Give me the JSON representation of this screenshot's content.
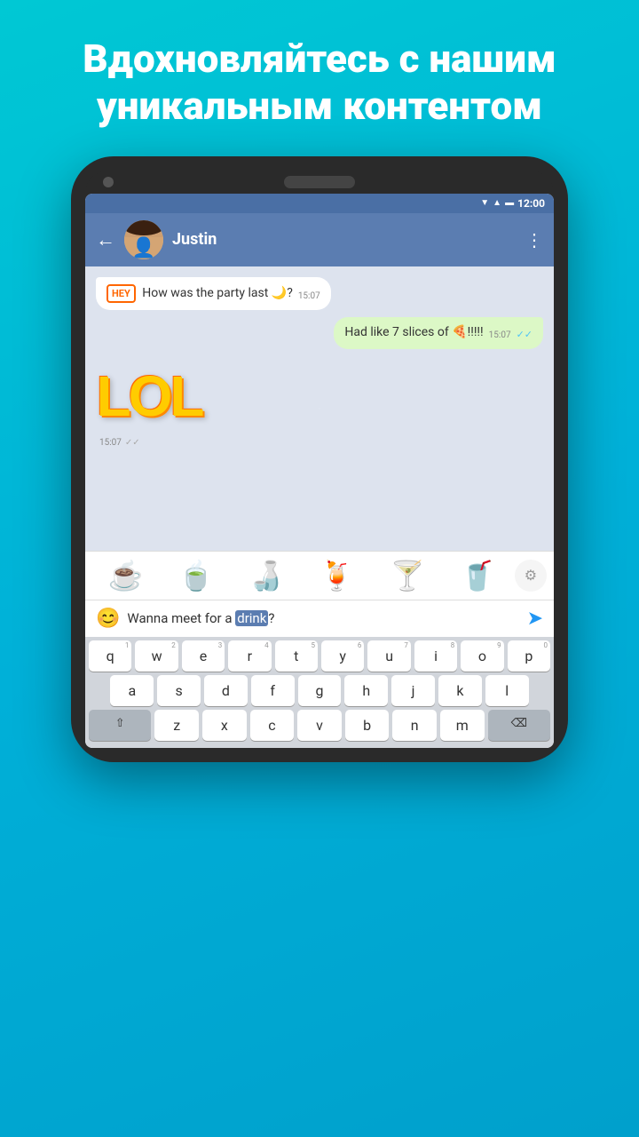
{
  "header": {
    "line1": "Вдохновляйтесь с нашим",
    "line2": "уникальным контентом"
  },
  "status_bar": {
    "time": "12:00"
  },
  "app_bar": {
    "contact_name": "Justin",
    "back_label": "←",
    "menu_label": "⋮"
  },
  "messages": [
    {
      "id": "msg1",
      "type": "received",
      "text": "How was the party last 🌙?",
      "time": "15:07",
      "has_hey": true
    },
    {
      "id": "msg2",
      "type": "sent",
      "text": "Had like 7 slices of 🍕!!!!!",
      "time": "15:07",
      "has_check": true
    },
    {
      "id": "msg3",
      "type": "lol_sticker",
      "text": "LOL",
      "time": "15:07"
    }
  ],
  "sticker_panel": {
    "stickers": [
      "☕",
      "🍵",
      "🍶",
      "🍹",
      "🍸",
      "🥤"
    ]
  },
  "input": {
    "text_before": "Wanna meet for a ",
    "highlighted": "drink",
    "text_after": "?",
    "emoji_label": "😊"
  },
  "keyboard": {
    "rows": [
      [
        "q",
        "w",
        "e",
        "r",
        "t",
        "y",
        "u",
        "i",
        "o",
        "p"
      ],
      [
        "a",
        "s",
        "d",
        "f",
        "g",
        "h",
        "j",
        "k",
        "l"
      ],
      [
        "z",
        "x",
        "c",
        "v",
        "b",
        "n",
        "m"
      ]
    ],
    "numbers": [
      "1",
      "2",
      "3",
      "4",
      "5",
      "6",
      "7",
      "8",
      "9",
      "0"
    ]
  }
}
